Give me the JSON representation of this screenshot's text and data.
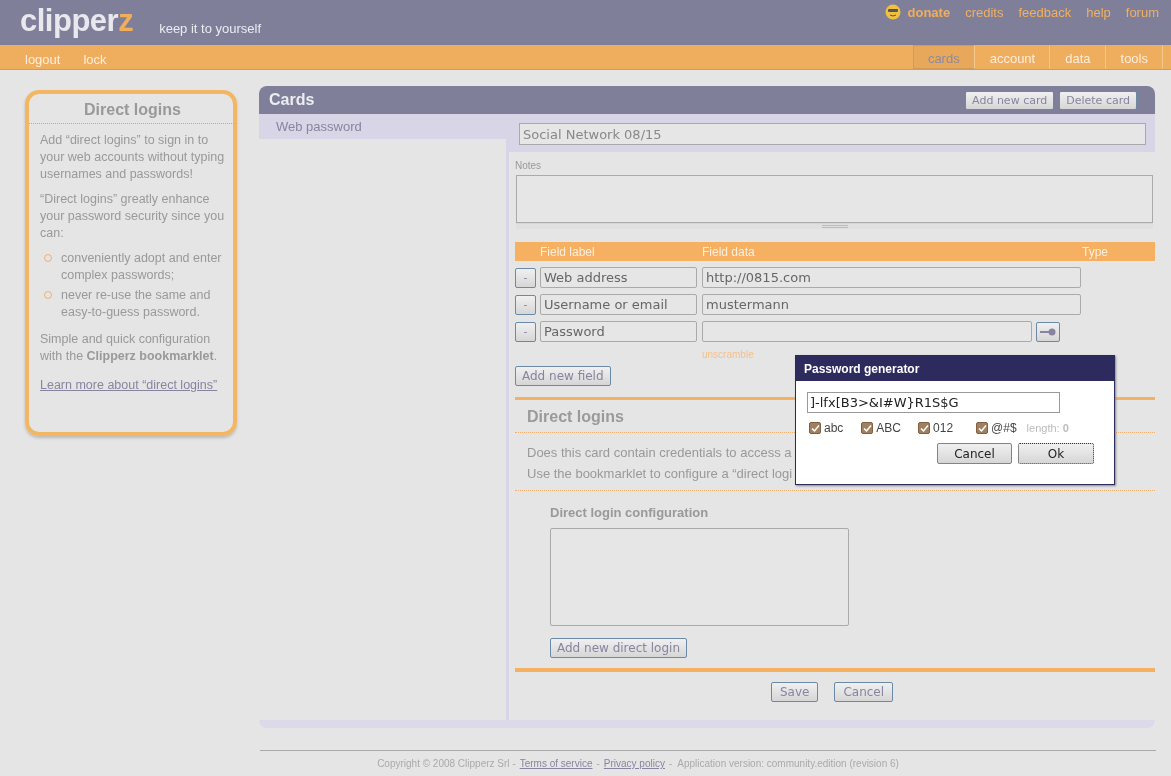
{
  "header": {
    "logo": {
      "text": "clipper",
      "accent": "z"
    },
    "tagline": "keep it to yourself",
    "links": [
      {
        "label": "donate",
        "kind": "donate"
      },
      {
        "label": "credits",
        "kind": "plain"
      },
      {
        "label": "feedback",
        "kind": "plain"
      },
      {
        "label": "help",
        "kind": "plain"
      },
      {
        "label": "forum",
        "kind": "plain"
      }
    ]
  },
  "nav": {
    "left": [
      "logout",
      "lock"
    ],
    "tabs": [
      {
        "label": "cards",
        "selected": true
      },
      {
        "label": "account",
        "selected": false
      },
      {
        "label": "data",
        "selected": false
      },
      {
        "label": "tools",
        "selected": false
      }
    ]
  },
  "help_box": {
    "title": "Direct logins",
    "paragraphs": [
      "Add “direct logins” to sign in to your web accounts without typing usernames and passwords!",
      "“Direct logins” greatly enhance your password security since you can:"
    ],
    "bullets": [
      "conveniently adopt and enter complex passwords;",
      "never re-use the same and easy-to-guess password."
    ],
    "closing": "Simple and quick configuration with the **Clipperz bookmarklet**.",
    "link": "Learn more about “direct logins”"
  },
  "cards": {
    "title": "Cards",
    "buttons": [
      "Add new card",
      "Delete card"
    ],
    "list": [
      {
        "label": "Web password",
        "selected": true
      }
    ],
    "card_title": "Social Network 08/15",
    "notes_label": "Notes",
    "columns": [
      "Field label",
      "Field data",
      "Type"
    ],
    "fields": [
      {
        "kind": "text",
        "remove": "-",
        "label": "Web address",
        "value": "http://0815.com"
      },
      {
        "kind": "text",
        "remove": "-",
        "label": "Username or email",
        "value": "mustermann"
      },
      {
        "kind": "password",
        "remove": "-",
        "label": "Password",
        "reveal": "unscramble"
      }
    ],
    "add_field": "Add new field",
    "direct_logins": {
      "title": "Direct logins",
      "lines": [
        "Does this card contain credentials to access a",
        "Use the bookmarklet to configure a “direct logi"
      ],
      "config_title": "Direct login configuration",
      "add_button": "Add new direct login"
    },
    "actions": [
      "Save",
      "Cancel"
    ]
  },
  "password_generator": {
    "title": "Password generator",
    "value": "]-lfx[B3>&I#W}R1S$G",
    "options": [
      {
        "label": "abc",
        "checked": true
      },
      {
        "label": "ABC",
        "checked": true
      },
      {
        "label": "012",
        "checked": true
      },
      {
        "label": "@#$",
        "checked": true
      }
    ],
    "length_label": "length:",
    "length_value": "0",
    "buttons": [
      {
        "label": "Cancel",
        "focused": false
      },
      {
        "label": "Ok",
        "focused": true
      }
    ]
  },
  "footer": [
    {
      "kind": "text",
      "text": "Copyright © 2008 Clipperz Srl -"
    },
    {
      "kind": "link",
      "text": "Terms of service"
    },
    {
      "kind": "text",
      "text": "-"
    },
    {
      "kind": "link",
      "text": "Privacy policy"
    },
    {
      "kind": "text",
      "text": "-  Application version: community.edition (revision 6)"
    }
  ]
}
